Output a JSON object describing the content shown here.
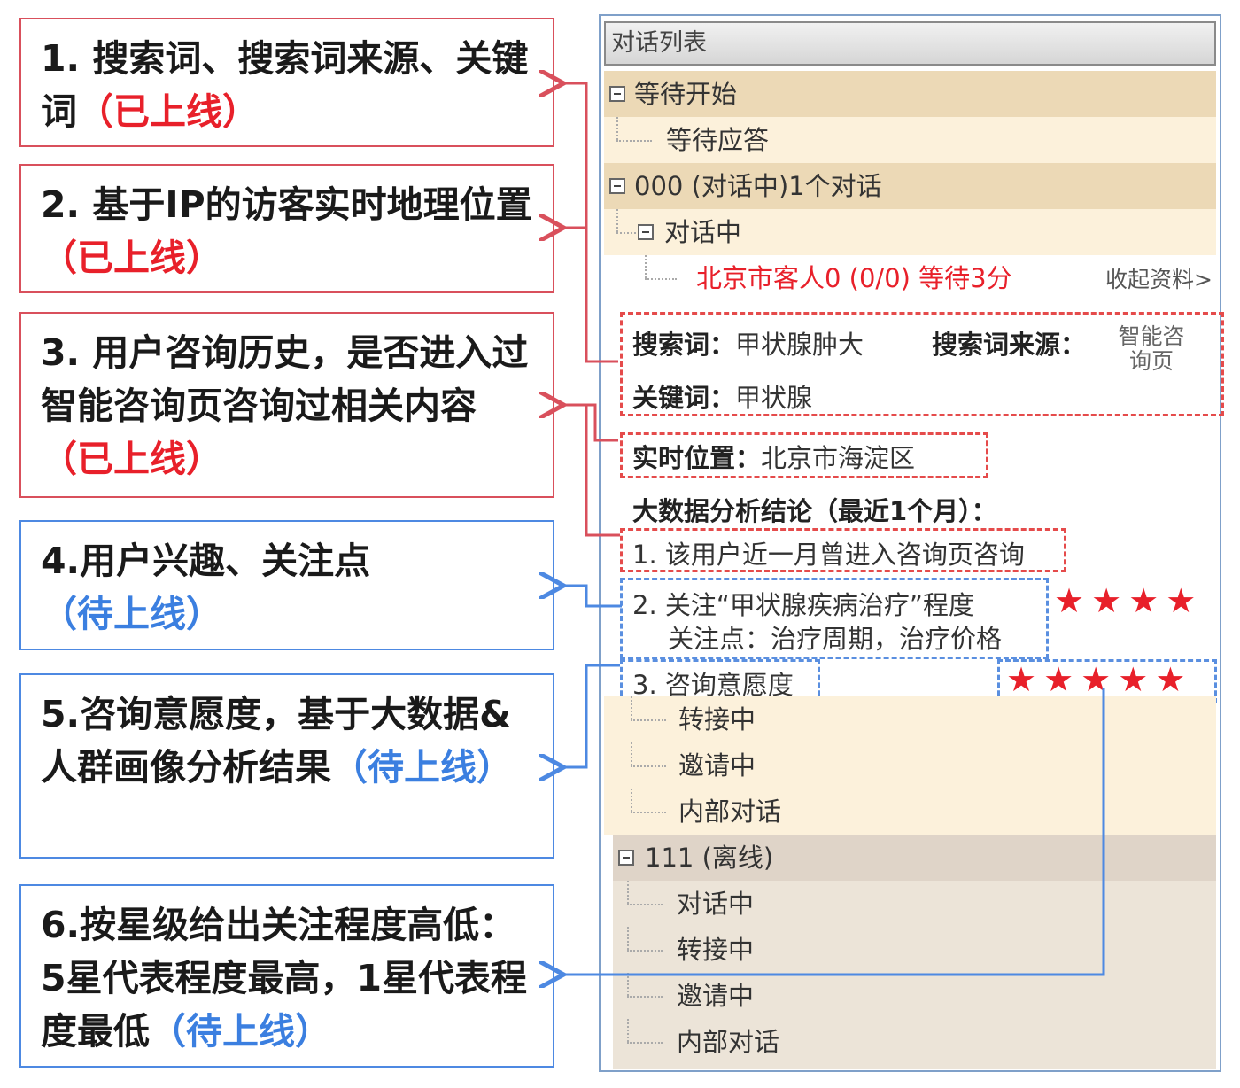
{
  "notes": [
    {
      "text": "1. 搜索词、搜索词来源、关键词",
      "status": "（已上线）"
    },
    {
      "text": "2. 基于IP的访客实时地理位置",
      "status": "（已上线）"
    },
    {
      "text": "3. 用户咨询历史，是否进入过智能咨询页咨询过相关内容",
      "status": "（已上线）"
    },
    {
      "text": "4.用户兴趣、关注点",
      "status": "（待上线）"
    },
    {
      "text": "5.咨询意愿度，基于大数据&人群画像分析结果",
      "status": "（待上线）"
    },
    {
      "text": "6.按星级给出关注程度高低：5星代表程度最高，1星代表程度最低",
      "status": "（待上线）"
    }
  ],
  "panel": {
    "title": "对话列表",
    "group_waiting": "等待开始",
    "waiting_reply": "等待应答",
    "group_000": "000 (对话中)1个对话",
    "in_conversation": "对话中",
    "visitor": "北京市客人0 (0/0) 等待3分",
    "collapse_link": "收起资料>",
    "search_word_label": "搜索词：",
    "search_word": "甲状腺肿大",
    "search_source_label": "搜索词来源：",
    "search_source": "智能咨询页",
    "keyword_label": "关键词：",
    "keyword": "甲状腺",
    "location_label": "实时位置：",
    "location": "北京市海淀区",
    "analysis_title": "大数据分析结论（最近1个月）：",
    "analysis_1": "1. 该用户近一月曾进入咨询页咨询",
    "analysis_2": "2. 关注“甲状腺疾病治疗”程度",
    "analysis_2_sub": "关注点：治疗周期，治疗价格",
    "analysis_2_stars": 4,
    "analysis_3": "3. 咨询意愿度",
    "analysis_3_stars": 5,
    "transferring": "转接中",
    "inviting": "邀请中",
    "internal": "内部对话",
    "group_111": "111 (离线)",
    "offline_items": [
      "对话中",
      "转接中",
      "邀请中",
      "内部对话"
    ]
  },
  "colors": {
    "online": "#e8202a",
    "pending": "#3b7fe0",
    "red_box": "#d9505c",
    "blue_box": "#4d89e2"
  }
}
